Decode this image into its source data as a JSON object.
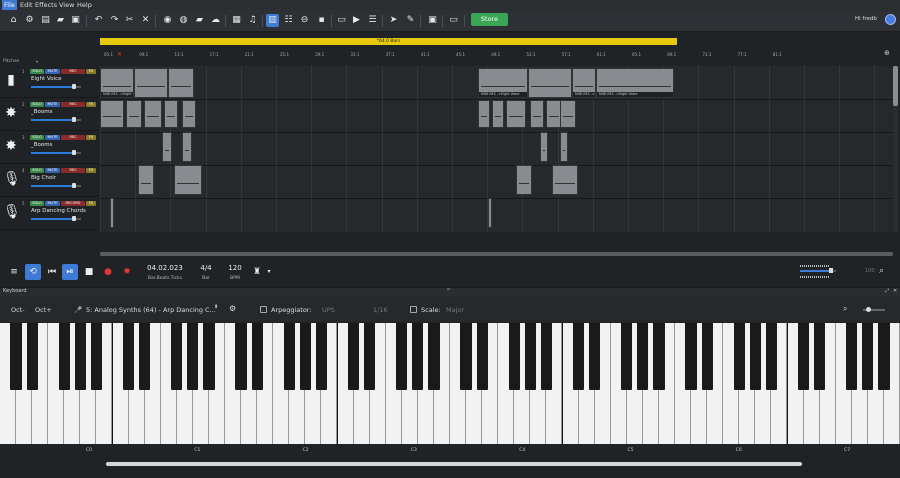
{
  "menu": {
    "items": [
      "File",
      "Edit",
      "Effects",
      "View",
      "Help"
    ]
  },
  "toolbar": {
    "store_label": "Store",
    "greeting": "Hi fredb"
  },
  "timeline": {
    "loop_label": "*64.0 Bars",
    "ruler_ticks": [
      "05:1",
      "09:1",
      "13:1",
      "17:1",
      "21:1",
      "25:1",
      "29:1",
      "33:1",
      "37:1",
      "41:1",
      "45:1",
      "49:1",
      "53:1",
      "57:1",
      "61:1",
      "65:1",
      "69:1",
      "73:1",
      "77:1",
      "81:1"
    ],
    "pitches_label": "Pitches"
  },
  "tracks": [
    {
      "num": "1",
      "name": "Eight Voice",
      "icon": "piano-icon",
      "volume": 0.85
    },
    {
      "num": "2",
      "name": "_Booms",
      "icon": "explosion-icon",
      "volume": 0.85
    },
    {
      "num": "3",
      "name": "_Booms",
      "icon": "explosion-icon",
      "volume": 0.85
    },
    {
      "num": "4",
      "name": "Big Choir",
      "icon": "microphone-icon",
      "volume": 0.85
    },
    {
      "num": "5",
      "name": "Arp Dancing Chords",
      "icon": "microphone-icon",
      "volume": 0.85
    }
  ],
  "track_badges": {
    "solo": "SOLO",
    "mute": "MUTE",
    "rec": "REC",
    "rec_long": "RECORD",
    "fx": "FX"
  },
  "clip_labels": {
    "a": "MIDI REC ->Eight Voice",
    "b": "MIDI REC ->Eight Voice",
    "c": "MIDI REC ->Eight Voice",
    "d": "MIDI REC ->Eight Voice"
  },
  "transport": {
    "position": "04.02.023",
    "position_label": "Bar.Beats.Ticks",
    "time_signature": "4/4",
    "time_signature_label": "Bar",
    "tempo": "120",
    "tempo_label": "BPM",
    "master_volume": 0.85,
    "aux_value": "100"
  },
  "keyboard": {
    "title": "Keyboard",
    "octave_down": "Oct-",
    "octave_up": "Oct+",
    "instrument": "5: Analog Synths (64) - Arp Dancing C...",
    "arpeggiator_label": "Arpeggiator:",
    "arp_mode": "UPS",
    "arp_rate": "1/16",
    "scale_label": "Scale:",
    "scale_value": "Major",
    "octave_labels": [
      "C0",
      "C1",
      "C2",
      "C3",
      "C4",
      "C5",
      "C6",
      "C7"
    ]
  }
}
